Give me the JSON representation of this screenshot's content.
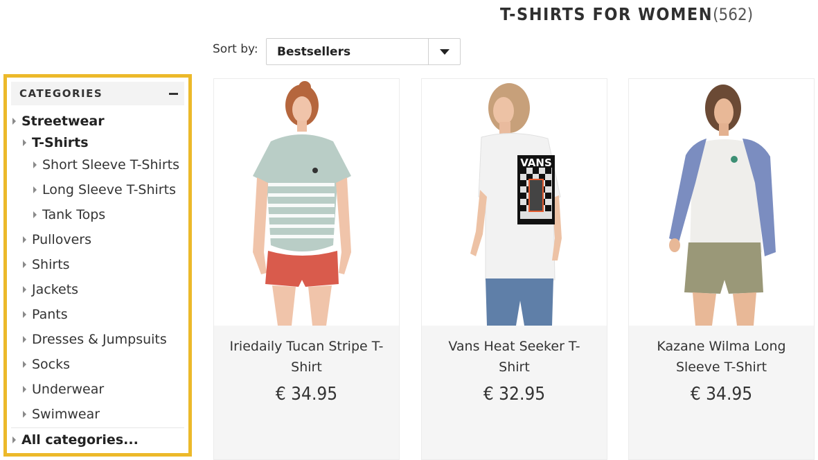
{
  "page": {
    "title": "T-SHIRTS FOR WOMEN",
    "count": "(562)"
  },
  "sort": {
    "label": "Sort by:",
    "value": "Bestsellers"
  },
  "sidebar": {
    "title": "CATEGORIES",
    "items": [
      {
        "label": "Streetwear",
        "level": 0,
        "bold": true
      },
      {
        "label": "T-Shirts",
        "level": 1,
        "bold": true
      },
      {
        "label": "Short Sleeve T-Shirts",
        "level": 2,
        "bold": false
      },
      {
        "label": "Long Sleeve T-Shirts",
        "level": 2,
        "bold": false
      },
      {
        "label": "Tank Tops",
        "level": 2,
        "bold": false
      },
      {
        "label": "Pullovers",
        "level": 1,
        "bold": false
      },
      {
        "label": "Shirts",
        "level": 1,
        "bold": false
      },
      {
        "label": "Jackets",
        "level": 1,
        "bold": false
      },
      {
        "label": "Pants",
        "level": 1,
        "bold": false
      },
      {
        "label": "Dresses & Jumpsuits",
        "level": 1,
        "bold": false
      },
      {
        "label": "Socks",
        "level": 1,
        "bold": false
      },
      {
        "label": "Underwear",
        "level": 1,
        "bold": false
      },
      {
        "label": "Swimwear",
        "level": 1,
        "bold": false
      },
      {
        "label": "All categories...",
        "level": 0,
        "bold": true
      }
    ]
  },
  "products": [
    {
      "name": "Iriedaily Tucan Stripe T-Shirt",
      "price": "€ 34.95"
    },
    {
      "name": "Vans Heat Seeker T-Shirt",
      "price": "€ 32.95"
    },
    {
      "name": "Kazane Wilma Long Sleeve T-Shirt",
      "price": "€ 34.95"
    }
  ],
  "graphics": {
    "vans_print": "VANS"
  },
  "colors": {
    "highlight_border": "#ecb92a",
    "card_info_bg": "#f5f5f5"
  }
}
